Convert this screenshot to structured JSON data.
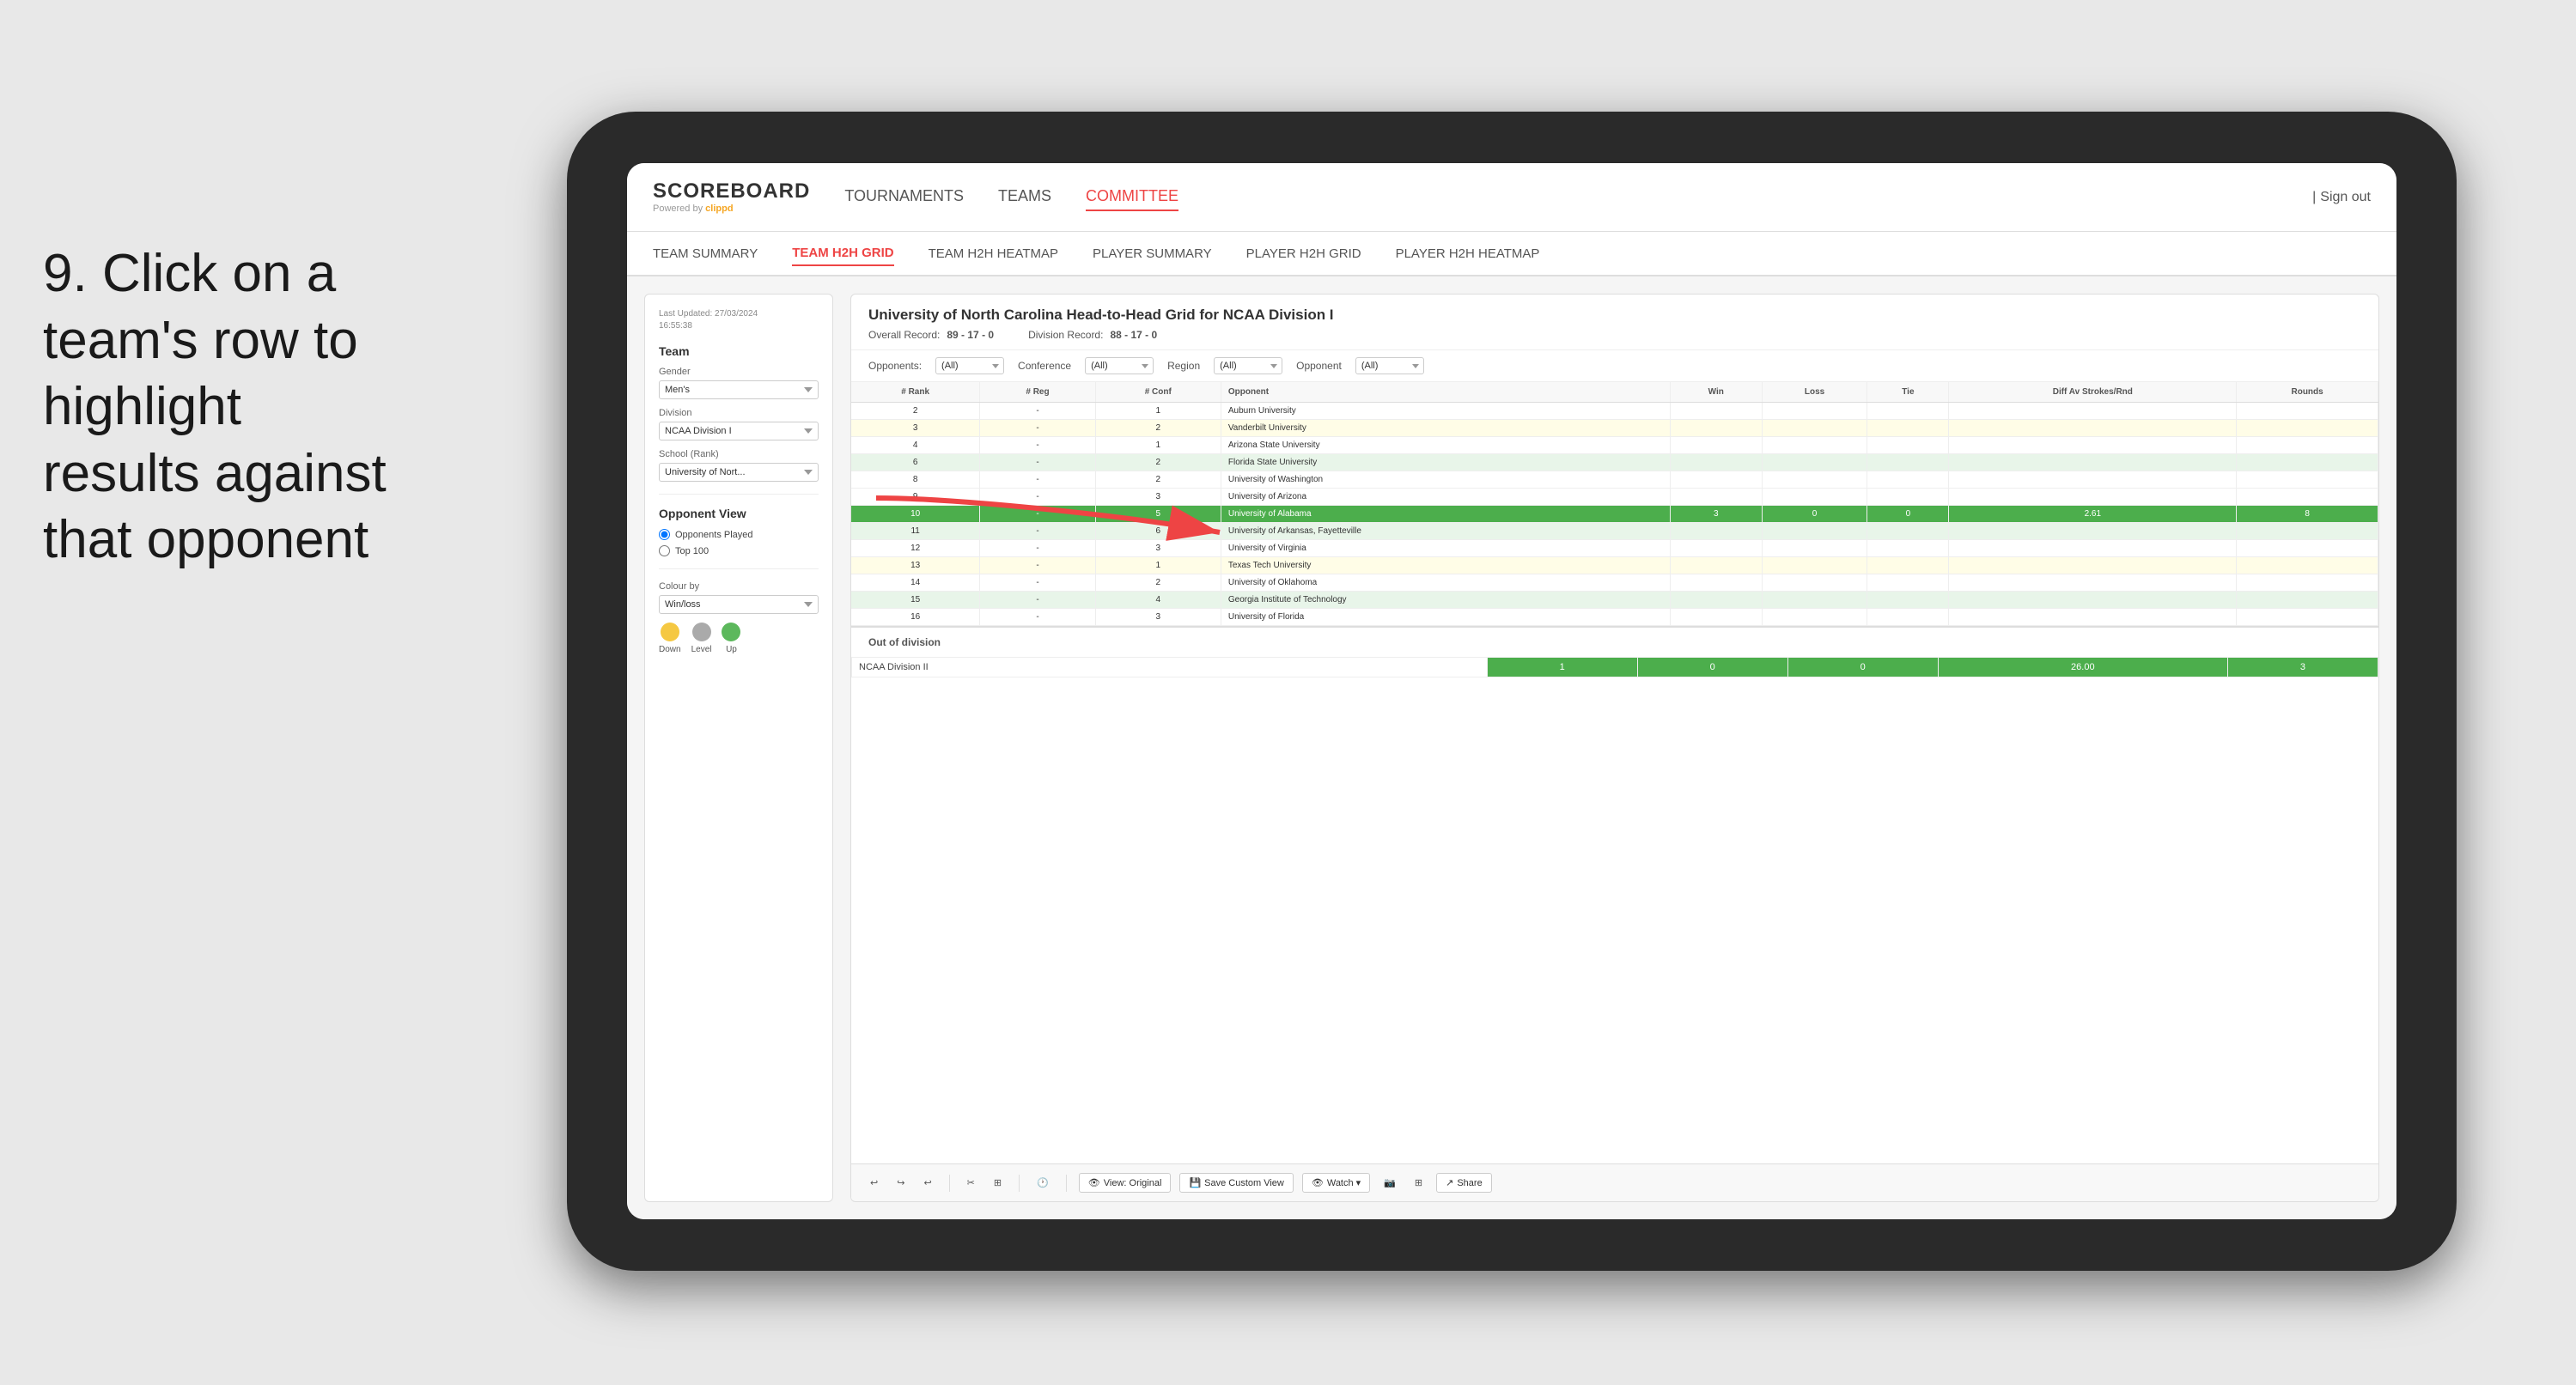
{
  "page": {
    "background_color": "#e8e8e8"
  },
  "instruction": {
    "step": "9.",
    "text": "Click on a team's row to highlight results against that opponent"
  },
  "app": {
    "logo": {
      "name": "SCOREBOARD",
      "powered_by": "Powered by",
      "brand": "clippd"
    },
    "nav_items": [
      {
        "label": "TOURNAMENTS",
        "active": false
      },
      {
        "label": "TEAMS",
        "active": false
      },
      {
        "label": "COMMITTEE",
        "active": true
      }
    ],
    "sign_out_label": "Sign out",
    "sub_nav_items": [
      {
        "label": "TEAM SUMMARY",
        "active": false
      },
      {
        "label": "TEAM H2H GRID",
        "active": true
      },
      {
        "label": "TEAM H2H HEATMAP",
        "active": false
      },
      {
        "label": "PLAYER SUMMARY",
        "active": false
      },
      {
        "label": "PLAYER H2H GRID",
        "active": false
      },
      {
        "label": "PLAYER H2H HEATMAP",
        "active": false
      }
    ]
  },
  "filter_panel": {
    "last_updated_label": "Last Updated: 27/03/2024",
    "last_updated_time": "16:55:38",
    "team_label": "Team",
    "gender_label": "Gender",
    "gender_value": "Men's",
    "division_label": "Division",
    "division_value": "NCAA Division I",
    "school_rank_label": "School (Rank)",
    "school_rank_value": "University of Nort...",
    "opponent_view_label": "Opponent View",
    "opponents_played_label": "Opponents Played",
    "top_100_label": "Top 100",
    "colour_by_label": "Colour by",
    "colour_by_value": "Win/loss",
    "legend_down": "Down",
    "legend_level": "Level",
    "legend_up": "Up"
  },
  "data_panel": {
    "title": "University of North Carolina Head-to-Head Grid for NCAA Division I",
    "overall_record_label": "Overall Record:",
    "overall_record_value": "89 - 17 - 0",
    "division_record_label": "Division Record:",
    "division_record_value": "88 - 17 - 0",
    "filters": {
      "opponents_label": "Opponents:",
      "opponents_value": "(All)",
      "conference_label": "Conference",
      "conference_value": "(All)",
      "region_label": "Region",
      "region_value": "(All)",
      "opponent_label": "Opponent",
      "opponent_value": "(All)"
    },
    "table_headers": [
      "# Rank",
      "# Reg",
      "# Conf",
      "Opponent",
      "Win",
      "Loss",
      "Tie",
      "Diff Av Strokes/Rnd",
      "Rounds"
    ],
    "rows": [
      {
        "rank": "2",
        "reg": "-",
        "conf": "1",
        "opponent": "Auburn University",
        "win": "",
        "loss": "",
        "tie": "",
        "diff": "",
        "rounds": "",
        "style": "normal"
      },
      {
        "rank": "3",
        "reg": "-",
        "conf": "2",
        "opponent": "Vanderbilt University",
        "win": "",
        "loss": "",
        "tie": "",
        "diff": "",
        "rounds": "",
        "style": "light-yellow"
      },
      {
        "rank": "4",
        "reg": "-",
        "conf": "1",
        "opponent": "Arizona State University",
        "win": "",
        "loss": "",
        "tie": "",
        "diff": "",
        "rounds": "",
        "style": "normal"
      },
      {
        "rank": "6",
        "reg": "-",
        "conf": "2",
        "opponent": "Florida State University",
        "win": "",
        "loss": "",
        "tie": "",
        "diff": "",
        "rounds": "",
        "style": "light-green"
      },
      {
        "rank": "8",
        "reg": "-",
        "conf": "2",
        "opponent": "University of Washington",
        "win": "",
        "loss": "",
        "tie": "",
        "diff": "",
        "rounds": "",
        "style": "normal"
      },
      {
        "rank": "9",
        "reg": "-",
        "conf": "3",
        "opponent": "University of Arizona",
        "win": "",
        "loss": "",
        "tie": "",
        "diff": "",
        "rounds": "",
        "style": "normal"
      },
      {
        "rank": "10",
        "reg": "-",
        "conf": "5",
        "opponent": "University of Alabama",
        "win": "3",
        "loss": "0",
        "tie": "0",
        "diff": "2.61",
        "rounds": "8",
        "style": "highlighted"
      },
      {
        "rank": "11",
        "reg": "-",
        "conf": "6",
        "opponent": "University of Arkansas, Fayetteville",
        "win": "",
        "loss": "",
        "tie": "",
        "diff": "",
        "rounds": "",
        "style": "light-green"
      },
      {
        "rank": "12",
        "reg": "-",
        "conf": "3",
        "opponent": "University of Virginia",
        "win": "",
        "loss": "",
        "tie": "",
        "diff": "",
        "rounds": "",
        "style": "normal"
      },
      {
        "rank": "13",
        "reg": "-",
        "conf": "1",
        "opponent": "Texas Tech University",
        "win": "",
        "loss": "",
        "tie": "",
        "diff": "",
        "rounds": "",
        "style": "light-yellow"
      },
      {
        "rank": "14",
        "reg": "-",
        "conf": "2",
        "opponent": "University of Oklahoma",
        "win": "",
        "loss": "",
        "tie": "",
        "diff": "",
        "rounds": "",
        "style": "normal"
      },
      {
        "rank": "15",
        "reg": "-",
        "conf": "4",
        "opponent": "Georgia Institute of Technology",
        "win": "",
        "loss": "",
        "tie": "",
        "diff": "",
        "rounds": "",
        "style": "light-green"
      },
      {
        "rank": "16",
        "reg": "-",
        "conf": "3",
        "opponent": "University of Florida",
        "win": "",
        "loss": "",
        "tie": "",
        "diff": "",
        "rounds": "",
        "style": "normal"
      }
    ],
    "out_of_division_label": "Out of division",
    "ood_row": {
      "division": "NCAA Division II",
      "win": "1",
      "loss": "0",
      "tie": "0",
      "diff": "26.00",
      "rounds": "3"
    }
  },
  "toolbar": {
    "undo_label": "↩",
    "redo_label": "↪",
    "view_label": "View: Original",
    "save_custom_label": "Save Custom View",
    "watch_label": "Watch ▾",
    "share_label": "Share"
  }
}
